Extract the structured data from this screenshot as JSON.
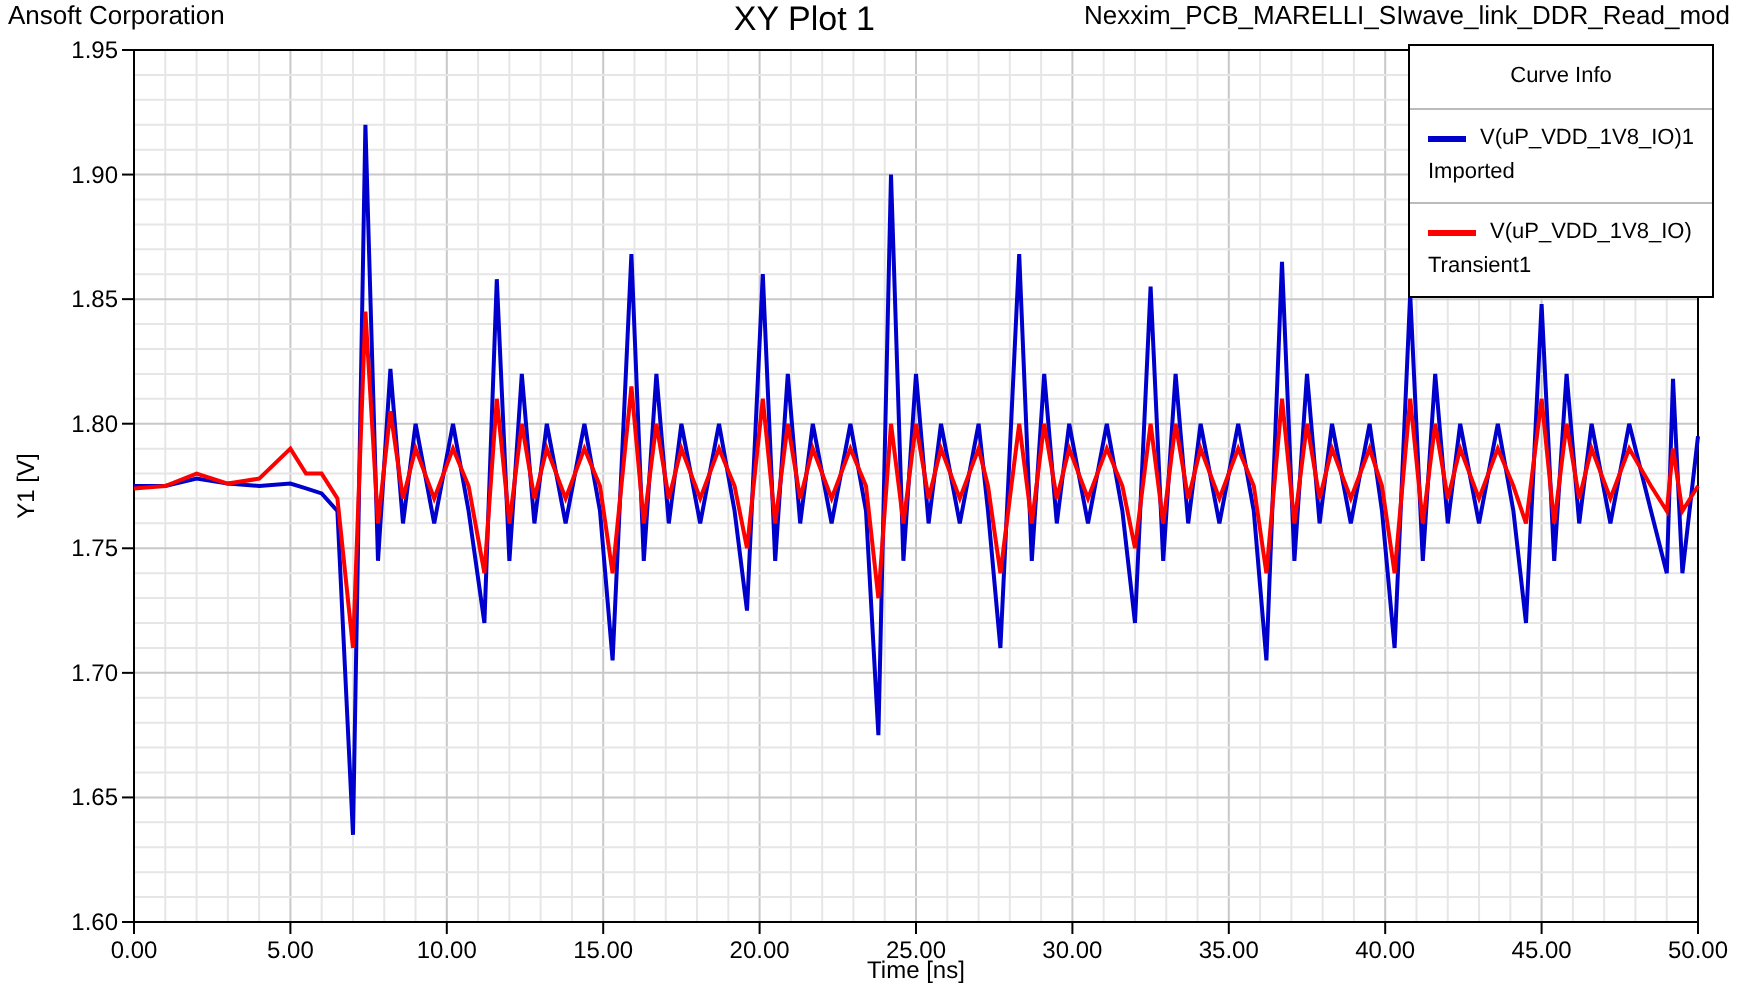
{
  "header": {
    "company": "Ansoft Corporation",
    "design": "Nexxim_PCB_MARELLI_SIwave_link_DDR_Read_mod"
  },
  "legend": {
    "title": "Curve Info",
    "notes": [
      "Imported",
      "Transient1"
    ]
  },
  "chart_data": {
    "type": "line",
    "title": "XY Plot 1",
    "xlabel": "Time [ns]",
    "grid": true,
    "ylabel": "Y1 [V]",
    "xlim": [
      0,
      50
    ],
    "ylim": [
      1.6,
      1.95
    ],
    "xticks": [
      {
        "value": 0,
        "label": "0.00"
      },
      {
        "value": 5,
        "label": "5.00"
      },
      {
        "value": 10,
        "label": "10.00"
      },
      {
        "value": 15,
        "label": "15.00"
      },
      {
        "value": 20,
        "label": "20.00"
      },
      {
        "value": 25,
        "label": "25.00"
      },
      {
        "value": 30,
        "label": "30.00"
      },
      {
        "value": 35,
        "label": "35.00"
      },
      {
        "value": 40,
        "label": "40.00"
      },
      {
        "value": 45,
        "label": "45.00"
      },
      {
        "value": 50,
        "label": "50.00"
      }
    ],
    "yticks": [
      {
        "value": 1.6,
        "label": "1.60"
      },
      {
        "value": 1.65,
        "label": "1.65"
      },
      {
        "value": 1.7,
        "label": "1.70"
      },
      {
        "value": 1.75,
        "label": "1.75"
      },
      {
        "value": 1.8,
        "label": "1.80"
      },
      {
        "value": 1.85,
        "label": "1.85"
      },
      {
        "value": 1.9,
        "label": "1.90"
      },
      {
        "value": 1.95,
        "label": "1.95"
      }
    ],
    "x": [
      0,
      1,
      2,
      3,
      4,
      5,
      5.5,
      6,
      6.5,
      7.0,
      7.4,
      7.8,
      8.2,
      8.6,
      9.0,
      9.6,
      10.2,
      10.7,
      11.2,
      11.6,
      12.0,
      12.4,
      12.8,
      13.2,
      13.8,
      14.4,
      14.9,
      15.3,
      15.9,
      16.3,
      16.7,
      17.1,
      17.5,
      18.1,
      18.7,
      19.2,
      19.6,
      20.1,
      20.5,
      20.9,
      21.3,
      21.7,
      22.3,
      22.9,
      23.4,
      23.8,
      24.2,
      24.6,
      25.0,
      25.4,
      25.8,
      26.4,
      27.0,
      27.3,
      27.7,
      28.3,
      28.7,
      29.1,
      29.5,
      29.9,
      30.5,
      31.1,
      31.6,
      32.0,
      32.5,
      32.9,
      33.3,
      33.7,
      34.1,
      34.7,
      35.3,
      35.8,
      36.2,
      36.7,
      37.1,
      37.5,
      37.9,
      38.3,
      38.9,
      39.5,
      39.9,
      40.3,
      40.8,
      41.2,
      41.6,
      42.0,
      42.4,
      43.0,
      43.6,
      44.1,
      44.5,
      45.0,
      45.4,
      45.8,
      46.2,
      46.6,
      47.2,
      47.8,
      48.5,
      49.0,
      49.2,
      49.5,
      50.0
    ],
    "series": [
      {
        "name": "V(uP_VDD_1V8_IO)1",
        "color": "#0000cc",
        "values": [
          1.775,
          1.775,
          1.778,
          1.776,
          1.775,
          1.776,
          1.774,
          1.772,
          1.765,
          1.635,
          1.92,
          1.745,
          1.822,
          1.76,
          1.8,
          1.76,
          1.8,
          1.765,
          1.72,
          1.858,
          1.745,
          1.82,
          1.76,
          1.8,
          1.76,
          1.8,
          1.765,
          1.705,
          1.868,
          1.745,
          1.82,
          1.76,
          1.8,
          1.76,
          1.8,
          1.765,
          1.725,
          1.86,
          1.745,
          1.82,
          1.76,
          1.8,
          1.76,
          1.8,
          1.765,
          1.675,
          1.9,
          1.745,
          1.82,
          1.76,
          1.8,
          1.76,
          1.8,
          1.765,
          1.71,
          1.868,
          1.745,
          1.82,
          1.76,
          1.8,
          1.76,
          1.8,
          1.765,
          1.72,
          1.855,
          1.745,
          1.82,
          1.76,
          1.8,
          1.76,
          1.8,
          1.765,
          1.705,
          1.865,
          1.745,
          1.82,
          1.76,
          1.8,
          1.76,
          1.8,
          1.765,
          1.71,
          1.852,
          1.745,
          1.82,
          1.76,
          1.8,
          1.76,
          1.8,
          1.765,
          1.72,
          1.848,
          1.745,
          1.82,
          1.76,
          1.8,
          1.76,
          1.8,
          1.765,
          1.74,
          1.818,
          1.74,
          1.795
        ]
      },
      {
        "name": "V(uP_VDD_1V8_IO)",
        "color": "#ff0000",
        "values": [
          1.774,
          1.775,
          1.78,
          1.776,
          1.778,
          1.79,
          1.78,
          1.78,
          1.77,
          1.71,
          1.845,
          1.76,
          1.805,
          1.77,
          1.79,
          1.77,
          1.79,
          1.775,
          1.74,
          1.81,
          1.76,
          1.8,
          1.77,
          1.79,
          1.77,
          1.79,
          1.775,
          1.74,
          1.815,
          1.76,
          1.8,
          1.77,
          1.79,
          1.77,
          1.79,
          1.775,
          1.75,
          1.81,
          1.76,
          1.8,
          1.77,
          1.79,
          1.77,
          1.79,
          1.775,
          1.73,
          1.8,
          1.76,
          1.8,
          1.77,
          1.79,
          1.77,
          1.79,
          1.775,
          1.74,
          1.8,
          1.76,
          1.8,
          1.77,
          1.79,
          1.77,
          1.79,
          1.775,
          1.75,
          1.8,
          1.76,
          1.8,
          1.77,
          1.79,
          1.77,
          1.79,
          1.775,
          1.74,
          1.81,
          1.76,
          1.8,
          1.77,
          1.79,
          1.77,
          1.79,
          1.775,
          1.74,
          1.81,
          1.76,
          1.8,
          1.77,
          1.79,
          1.77,
          1.79,
          1.775,
          1.76,
          1.81,
          1.76,
          1.8,
          1.77,
          1.79,
          1.77,
          1.79,
          1.775,
          1.765,
          1.79,
          1.765,
          1.775
        ]
      }
    ]
  }
}
